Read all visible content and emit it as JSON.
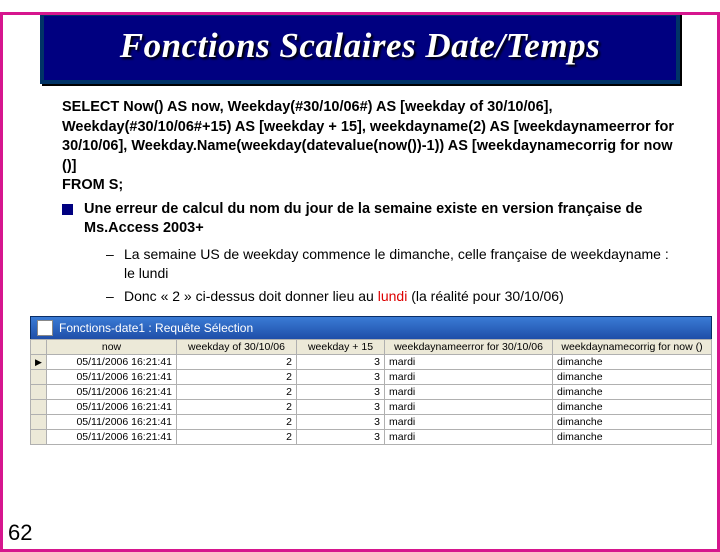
{
  "title": "Fonctions Scalaires Date/Temps",
  "sql": "SELECT Now() AS now, Weekday(#30/10/06#) AS [weekday of 30/10/06], Weekday(#30/10/06#+15) AS [weekday + 15], weekdayname(2) AS [weekdaynameerror for 30/10/06], Weekday.Name(weekday(datevalue(now())-1)) AS [weekdaynamecorrig for now ()]",
  "from": "FROM S;",
  "bullet": "Une erreur de calcul du nom du jour de la semaine existe en version française de Ms.Access 2003+",
  "dash1": "La semaine US de weekday commence le dimanche, celle française de weekdayname : le lundi",
  "dash2a": "Donc « 2 » ci-dessus doit donner lieu au ",
  "dash2_red": "lundi",
  "dash2b": "  (la réalité pour 30/10/06)",
  "window_title": "Fonctions-date1 : Requête Sélection",
  "headers": {
    "c0": "",
    "c1": "now",
    "c2": "weekday of 30/10/06",
    "c3": "weekday + 15",
    "c4": "weekdaynameerror for 30/10/06",
    "c5": "weekdaynamecorrig for now ()"
  },
  "rows": [
    {
      "now": "05/11/2006 16:21:41",
      "w": "2",
      "w15": "3",
      "err": "mardi",
      "corr": "dimanche"
    },
    {
      "now": "05/11/2006 16:21:41",
      "w": "2",
      "w15": "3",
      "err": "mardi",
      "corr": "dimanche"
    },
    {
      "now": "05/11/2006 16:21:41",
      "w": "2",
      "w15": "3",
      "err": "mardi",
      "corr": "dimanche"
    },
    {
      "now": "05/11/2006 16:21:41",
      "w": "2",
      "w15": "3",
      "err": "mardi",
      "corr": "dimanche"
    },
    {
      "now": "05/11/2006 16:21:41",
      "w": "2",
      "w15": "3",
      "err": "mardi",
      "corr": "dimanche"
    },
    {
      "now": "05/11/2006 16:21:41",
      "w": "2",
      "w15": "3",
      "err": "mardi",
      "corr": "dimanche"
    }
  ],
  "page": "62"
}
